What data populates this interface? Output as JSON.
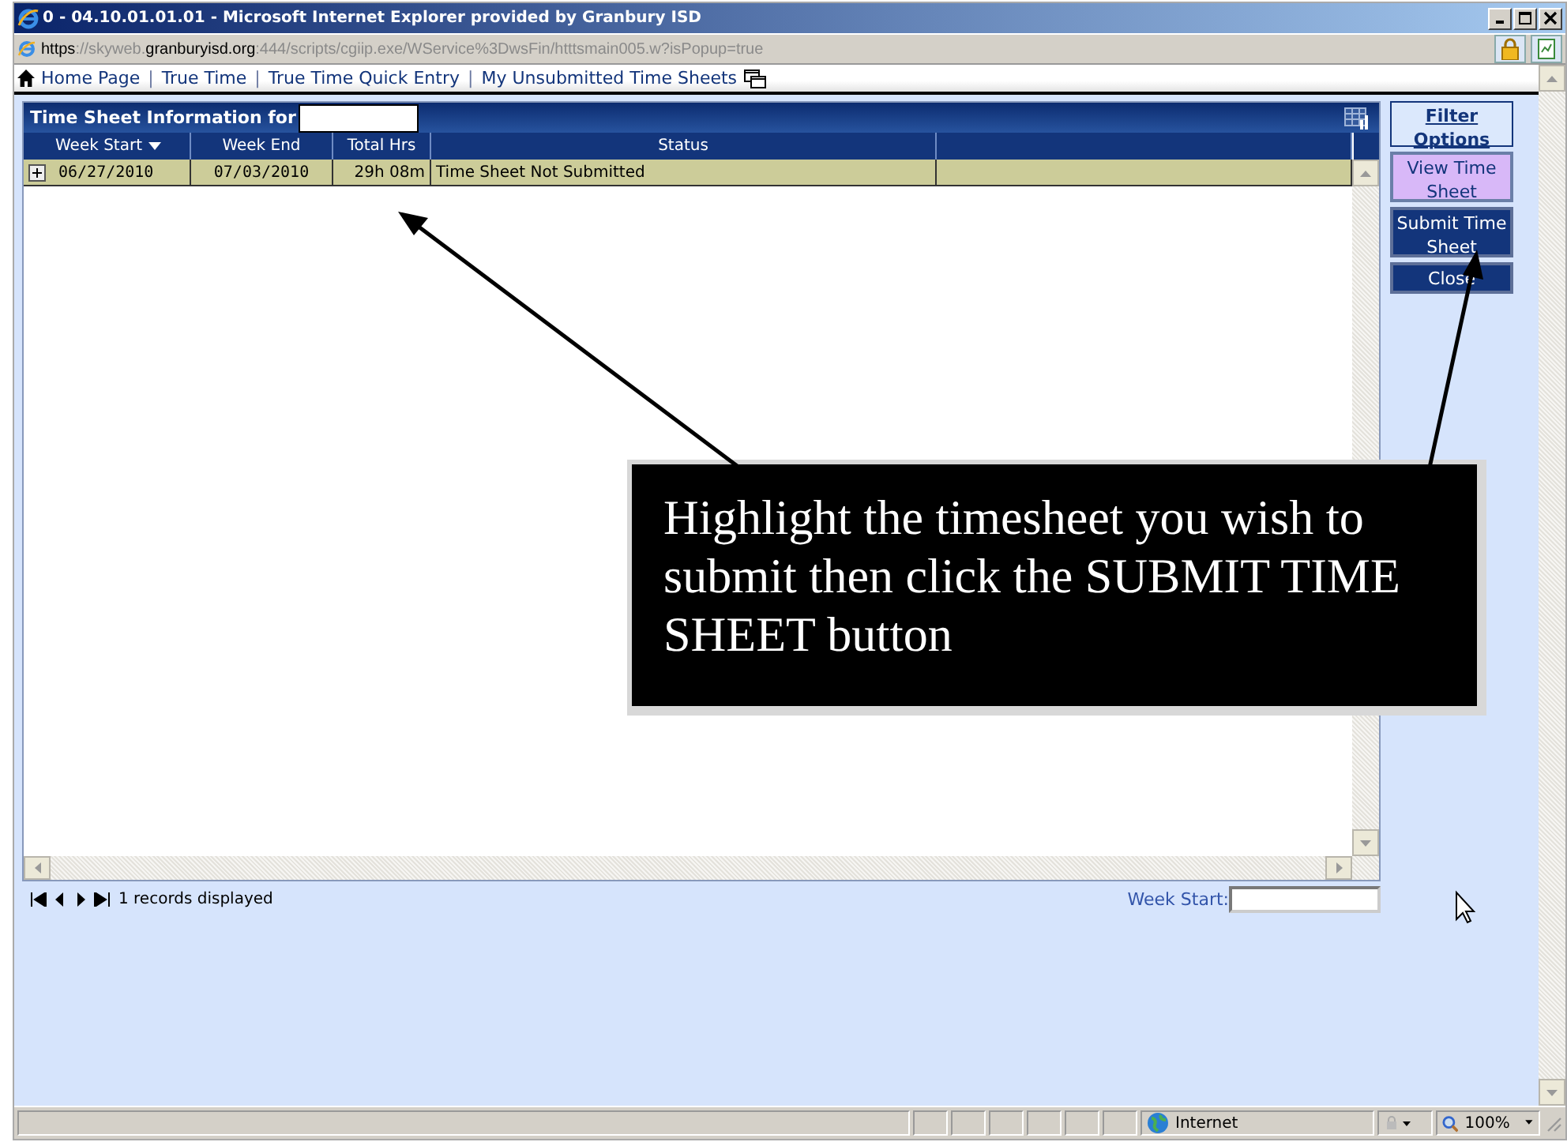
{
  "window": {
    "title": "0 - 04.10.01.01.01 - Microsoft Internet Explorer provided by Granbury ISD"
  },
  "address_bar": {
    "url": [
      {
        "text": "https",
        "strong": true
      },
      {
        "text": "://skyweb.",
        "strong": false
      },
      {
        "text": "granburyisd.org",
        "strong": true
      },
      {
        "text": ":444/scripts/cgiip.exe/WService%3DwsFin/htttsmain005.w?isPopup=true",
        "strong": false
      }
    ]
  },
  "nav": [
    {
      "kind": "link",
      "label": "Home Page"
    },
    {
      "kind": "separator",
      "label": "|"
    },
    {
      "kind": "link",
      "label": "True Time"
    },
    {
      "kind": "separator",
      "label": "|"
    },
    {
      "kind": "link",
      "label": "True Time Quick Entry"
    },
    {
      "kind": "separator",
      "label": "|"
    },
    {
      "kind": "link",
      "label": "My Unsubmitted Time Sheets"
    }
  ],
  "grid": {
    "title": "Time Sheet Information for",
    "columns": [
      {
        "label": "Week Start",
        "sorted": true
      },
      {
        "label": "Week End",
        "sorted": false
      },
      {
        "label": "Total Hrs",
        "sorted": false
      },
      {
        "label": "Status",
        "sorted": false
      }
    ],
    "rows": [
      {
        "selected": true,
        "expanded": false,
        "cells": [
          "06/27/2010",
          "07/03/2010",
          "29h 08m",
          "Time Sheet Not Submitted"
        ]
      }
    ],
    "records": "1 records displayed",
    "filter_label": "Week Start:"
  },
  "side_buttons": [
    {
      "kind": "link",
      "label": "Filter Options"
    },
    {
      "kind": "light",
      "label": "View Time Sheet"
    },
    {
      "kind": "dark",
      "label": "Submit Time Sheet"
    },
    {
      "kind": "dark",
      "label": "Close"
    }
  ],
  "callout": {
    "text": "Highlight the timesheet you wish to submit then click the SUBMIT TIME SHEET button"
  },
  "status_bar": {
    "zone": "Internet",
    "zoom": "100%"
  }
}
